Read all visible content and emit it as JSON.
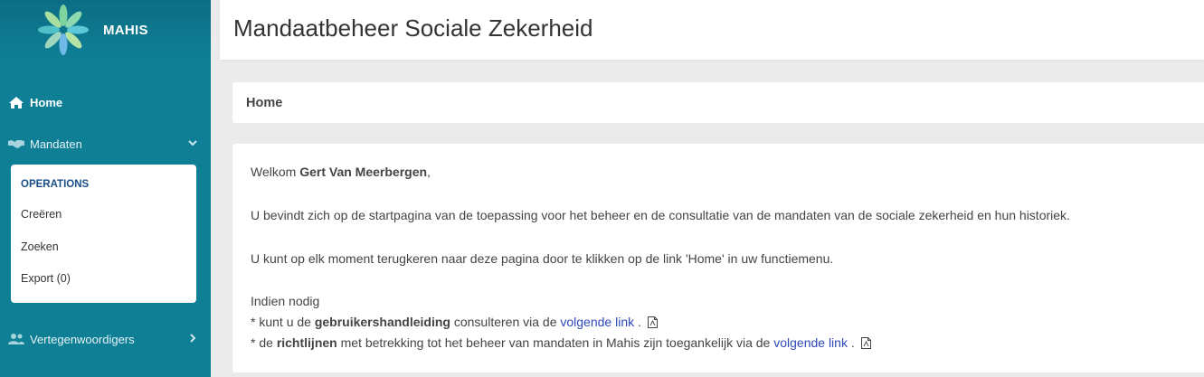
{
  "brand": {
    "name": "MAHIS"
  },
  "sidebar": {
    "home": "Home",
    "mandaten": "Mandaten",
    "submenu": {
      "header": "OPERATIONS",
      "items": [
        "Creëren",
        "Zoeken",
        "Export (0)"
      ]
    },
    "vertegenwoordigers": "Vertegenwoordigers"
  },
  "header": {
    "title": "Mandaatbeheer Sociale Zekerheid"
  },
  "breadcrumb": {
    "label": "Home"
  },
  "content": {
    "welcome_prefix": "Welkom",
    "user_name": "Gert Van Meerbergen",
    "welcome_suffix": ",",
    "para1": "U bevindt zich op de startpagina van de toepassing voor het beheer en de consultatie van de mandaten van de sociale zekerheid en hun historiek.",
    "para2": "U kunt op elk moment terugkeren naar deze pagina door te klikken op de link 'Home' in uw functiemenu.",
    "indien": "Indien nodig",
    "b1_prefix": "* kunt u de ",
    "b1_bold": "gebruikershandleiding",
    "b1_mid": " consulteren via de ",
    "b1_link": "volgende link",
    "b1_end": " .",
    "b2_prefix": "* de ",
    "b2_bold": "richtlijnen",
    "b2_mid": " met betrekking tot het beheer van mandaten in Mahis zijn toegankelijk via de  ",
    "b2_link": "volgende link",
    "b2_end": " ."
  },
  "colors": {
    "sidebar": "#0f7f96",
    "link": "#2e49b8",
    "submenu_header": "#1a4e86"
  }
}
